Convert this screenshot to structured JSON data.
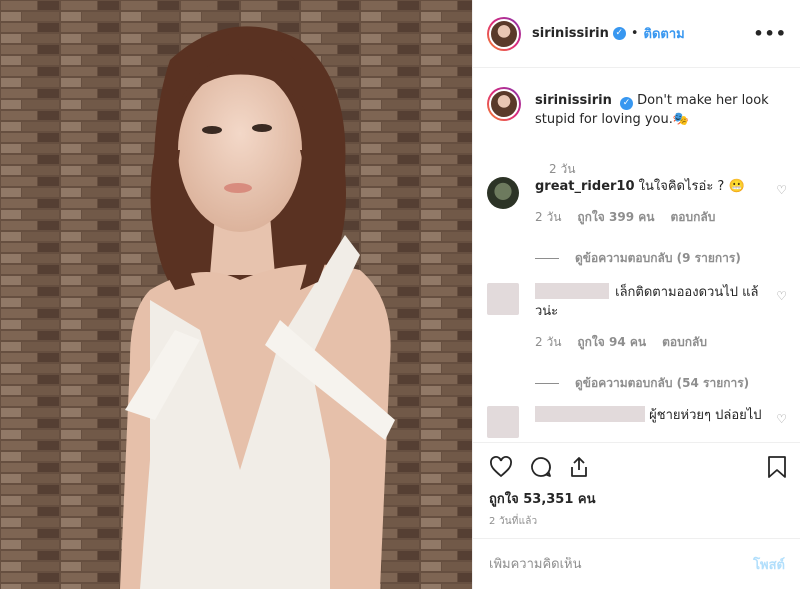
{
  "header": {
    "username": "sirinissirin",
    "separator": "•",
    "follow_label": "ติดตาม",
    "more_glyph": "•••"
  },
  "caption": {
    "username": "sirinissirin",
    "text": "Don't make her look stupid for loving you.",
    "emoji": "🎭",
    "time": "2 วัน"
  },
  "comments": [
    {
      "username": "great_rider10",
      "text": "ในใจคิดไรอ่ะ ?",
      "emoji": "😬",
      "time": "2 วัน",
      "likes": "ถูกใจ 399 คน",
      "reply": "ตอบกลับ",
      "view_replies": "ดูข้อความตอบกลับ (9 รายการ)"
    },
    {
      "username": "",
      "text": "เล็กติดตามอองดวนไป แล้วน่ะ",
      "time": "2 วัน",
      "likes": "ถูกใจ 94 คน",
      "reply": "ตอบกลับ",
      "view_replies": "ดูข้อความตอบกลับ (54 รายการ)"
    },
    {
      "username": "",
      "text": "ผู้ชายห่วยๆ ปล่อยไป"
    }
  ],
  "actions": {
    "likes": "ถูกใจ 53,351 คน",
    "time_ago": "2 วันที่แล้ว"
  },
  "add_comment": {
    "placeholder": "เพิ่มความคิดเห็น",
    "post_label": "โพสต์"
  },
  "colors": {
    "link": "#3897f0",
    "muted": "#8e8e8e",
    "post_disabled": "#b2dffc"
  }
}
